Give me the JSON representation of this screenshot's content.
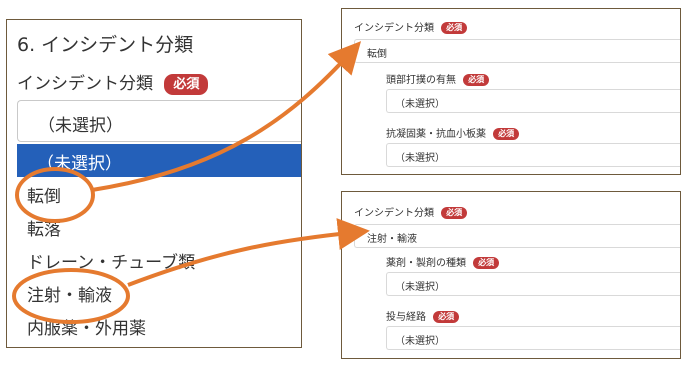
{
  "left_panel": {
    "section_title": "6. インシデント分類",
    "field_label": "インシデント分類",
    "required_badge": "必須",
    "selected_value": "（未選択）",
    "options": [
      "（未選択）",
      "転倒",
      "転落",
      "ドレーン・チューブ類",
      "注射・輸液",
      "内服薬・外用薬"
    ]
  },
  "right_top": {
    "field_label": "インシデント分類",
    "required_badge": "必須",
    "selected_value": "転倒",
    "sub_fields": [
      {
        "label": "頭部打撲の有無",
        "badge": "必須",
        "value": "（未選択）"
      },
      {
        "label": "抗凝固薬・抗血小板薬",
        "badge": "必須",
        "value": "（未選択）"
      }
    ]
  },
  "right_bottom": {
    "field_label": "インシデント分類",
    "required_badge": "必須",
    "selected_value": "注射・輸液",
    "sub_fields": [
      {
        "label": "薬剤・製剤の種類",
        "badge": "必須",
        "value": "（未選択）"
      },
      {
        "label": "投与経路",
        "badge": "必須",
        "value": "（未選択）"
      }
    ]
  },
  "colors": {
    "highlight": "#2460b9",
    "badge": "#c23a3a",
    "annotation": "#e57a2f",
    "border": "#6e5a3c"
  }
}
